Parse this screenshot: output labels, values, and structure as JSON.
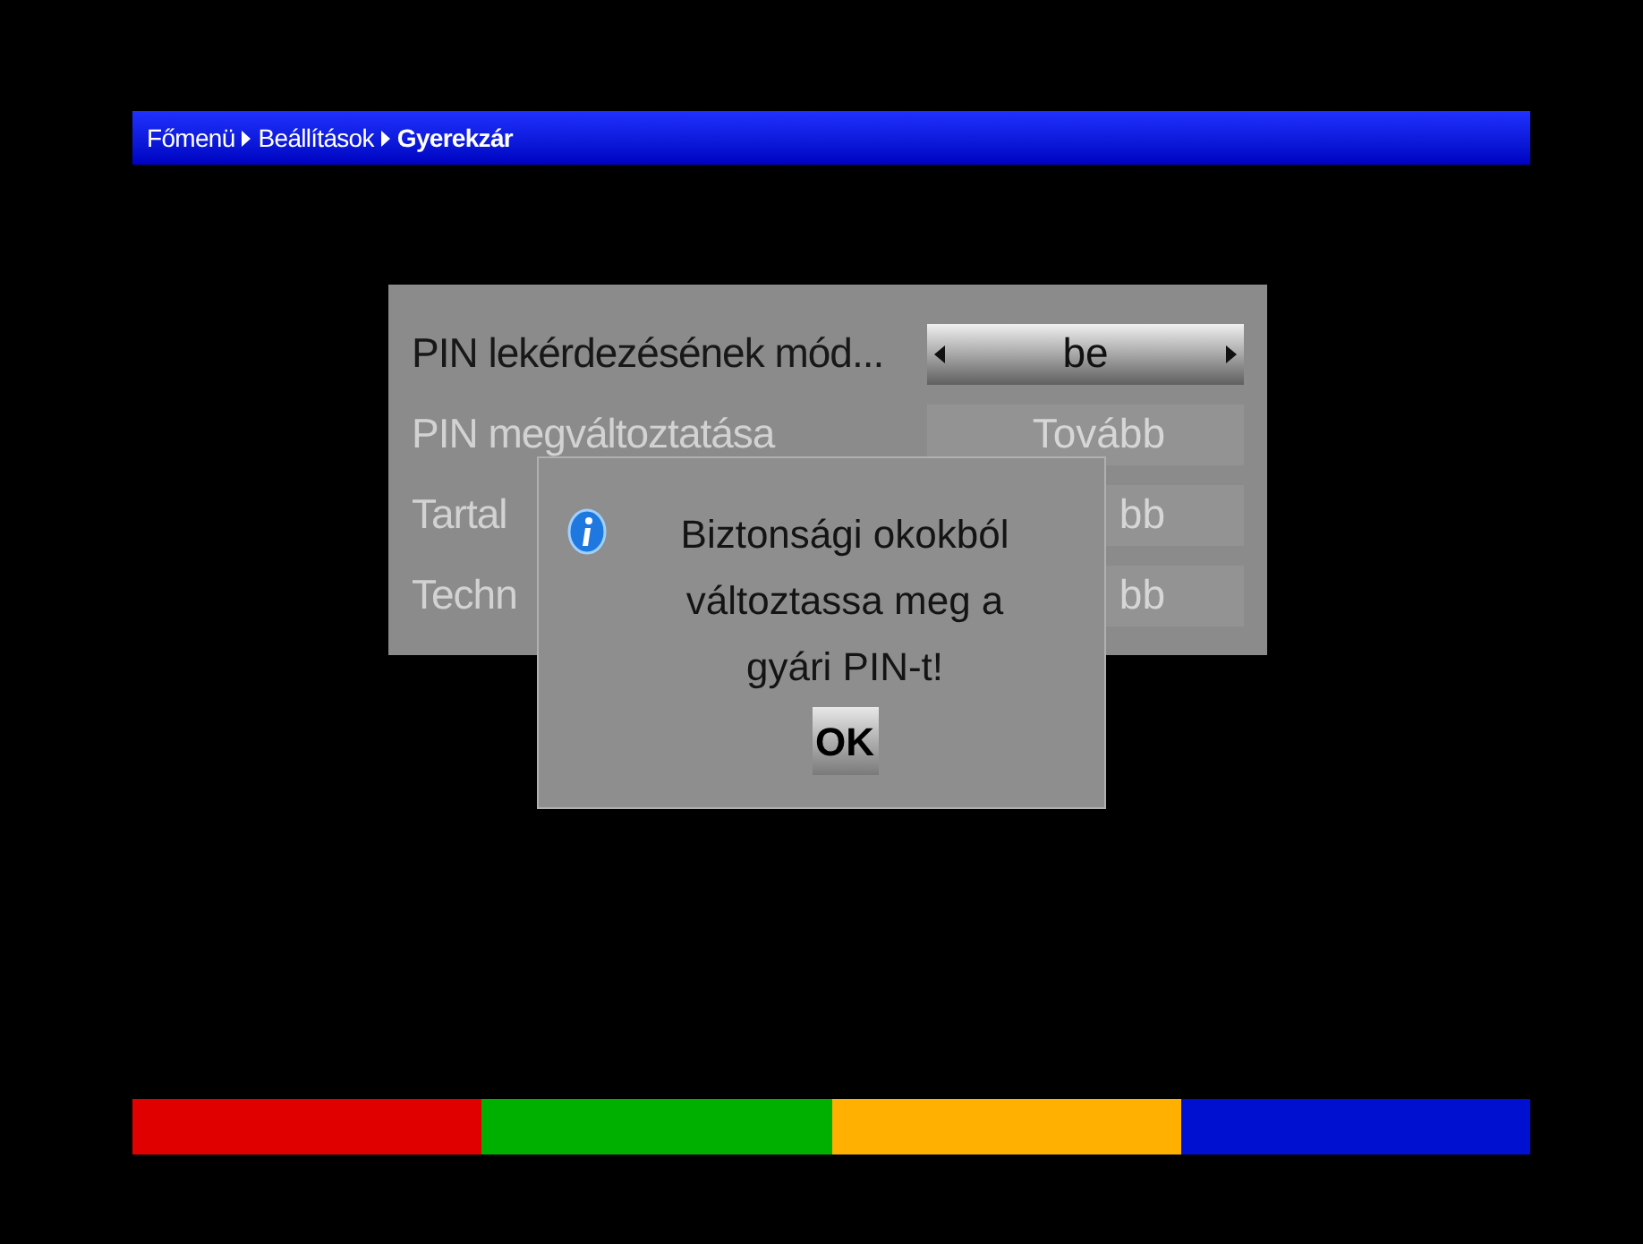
{
  "breadcrumb": [
    "Főmenü",
    "Beállítások",
    "Gyerekzár"
  ],
  "menu": [
    {
      "kind": "selector",
      "label": "PIN lekérdezésének mód...",
      "value": "be",
      "selected": true,
      "disabled": false
    },
    {
      "kind": "button",
      "label": "PIN megváltoztatása",
      "value": "Tovább",
      "selected": false,
      "disabled": true
    },
    {
      "kind": "button",
      "label": "Tartal",
      "value": "bb",
      "selected": false,
      "disabled": true
    },
    {
      "kind": "button",
      "label": "Techn",
      "value": "bb",
      "selected": false,
      "disabled": true
    }
  ],
  "dialog": {
    "lines": [
      "Biztonsági okokból",
      "változtassa meg a",
      "gyári PIN-t!"
    ],
    "button": "OK"
  },
  "color_keys": [
    {
      "color": "#e00000"
    },
    {
      "color": "#00b000"
    },
    {
      "color": "#ffb000"
    },
    {
      "color": "#0010d0"
    }
  ]
}
